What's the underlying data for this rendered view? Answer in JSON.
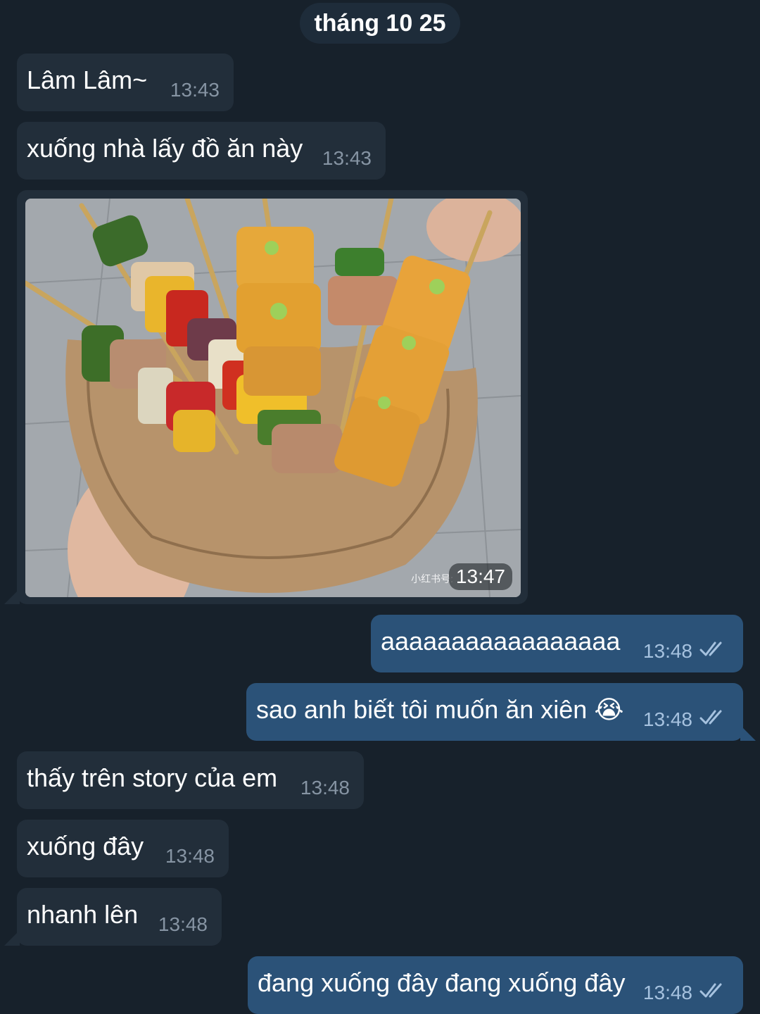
{
  "date_header": "tháng 10 25",
  "messages": [
    {
      "text": "Lâm Lâm~",
      "time": "13:43"
    },
    {
      "text": "xuống nhà lấy đồ ăn này",
      "time": "13:43"
    },
    {
      "time": "13:47",
      "watermark": "小红书号:"
    },
    {
      "text": "aaaaaaaaaaaaaaaaa",
      "time": "13:48"
    },
    {
      "text": "sao anh biết tôi muốn ăn xiên 😭",
      "time": "13:48"
    },
    {
      "text": "thấy trên story của em",
      "time": "13:48"
    },
    {
      "text": "xuống đây",
      "time": "13:48"
    },
    {
      "text": "nhanh lên",
      "time": "13:48"
    },
    {
      "text": "đang xuống đây đang xuống đây",
      "time": "13:48"
    }
  ],
  "colors": {
    "background": "#17212b",
    "incoming_bubble": "#222e3a",
    "outgoing_bubble": "#2b5278",
    "read_check": "#a6c2df"
  },
  "icons": {
    "read_status": "double-check-icon"
  }
}
